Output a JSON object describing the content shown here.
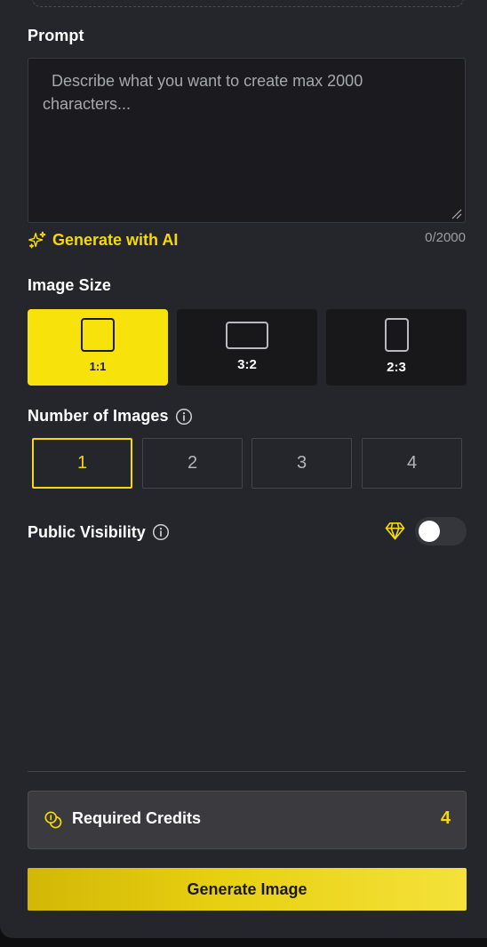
{
  "prompt": {
    "title": "Prompt",
    "placeholder": "  Describe what you want to create max 2000 characters...",
    "value": "",
    "char_count": "0/2000",
    "generate_ai_label": "Generate with AI"
  },
  "image_size": {
    "title": "Image Size",
    "options": [
      {
        "label": "1:1",
        "selected": true
      },
      {
        "label": "3:2",
        "selected": false
      },
      {
        "label": "2:3",
        "selected": false
      }
    ]
  },
  "number_of_images": {
    "title": "Number of Images",
    "options": [
      "1",
      "2",
      "3",
      "4"
    ],
    "selected": "1"
  },
  "public_visibility": {
    "title": "Public Visibility",
    "enabled": false
  },
  "credits": {
    "label": "Required Credits",
    "value": "4"
  },
  "generate_button_label": "Generate Image",
  "colors": {
    "accent": "#f5d90a",
    "panel_bg": "#25262b",
    "card_bg": "#18181b"
  }
}
